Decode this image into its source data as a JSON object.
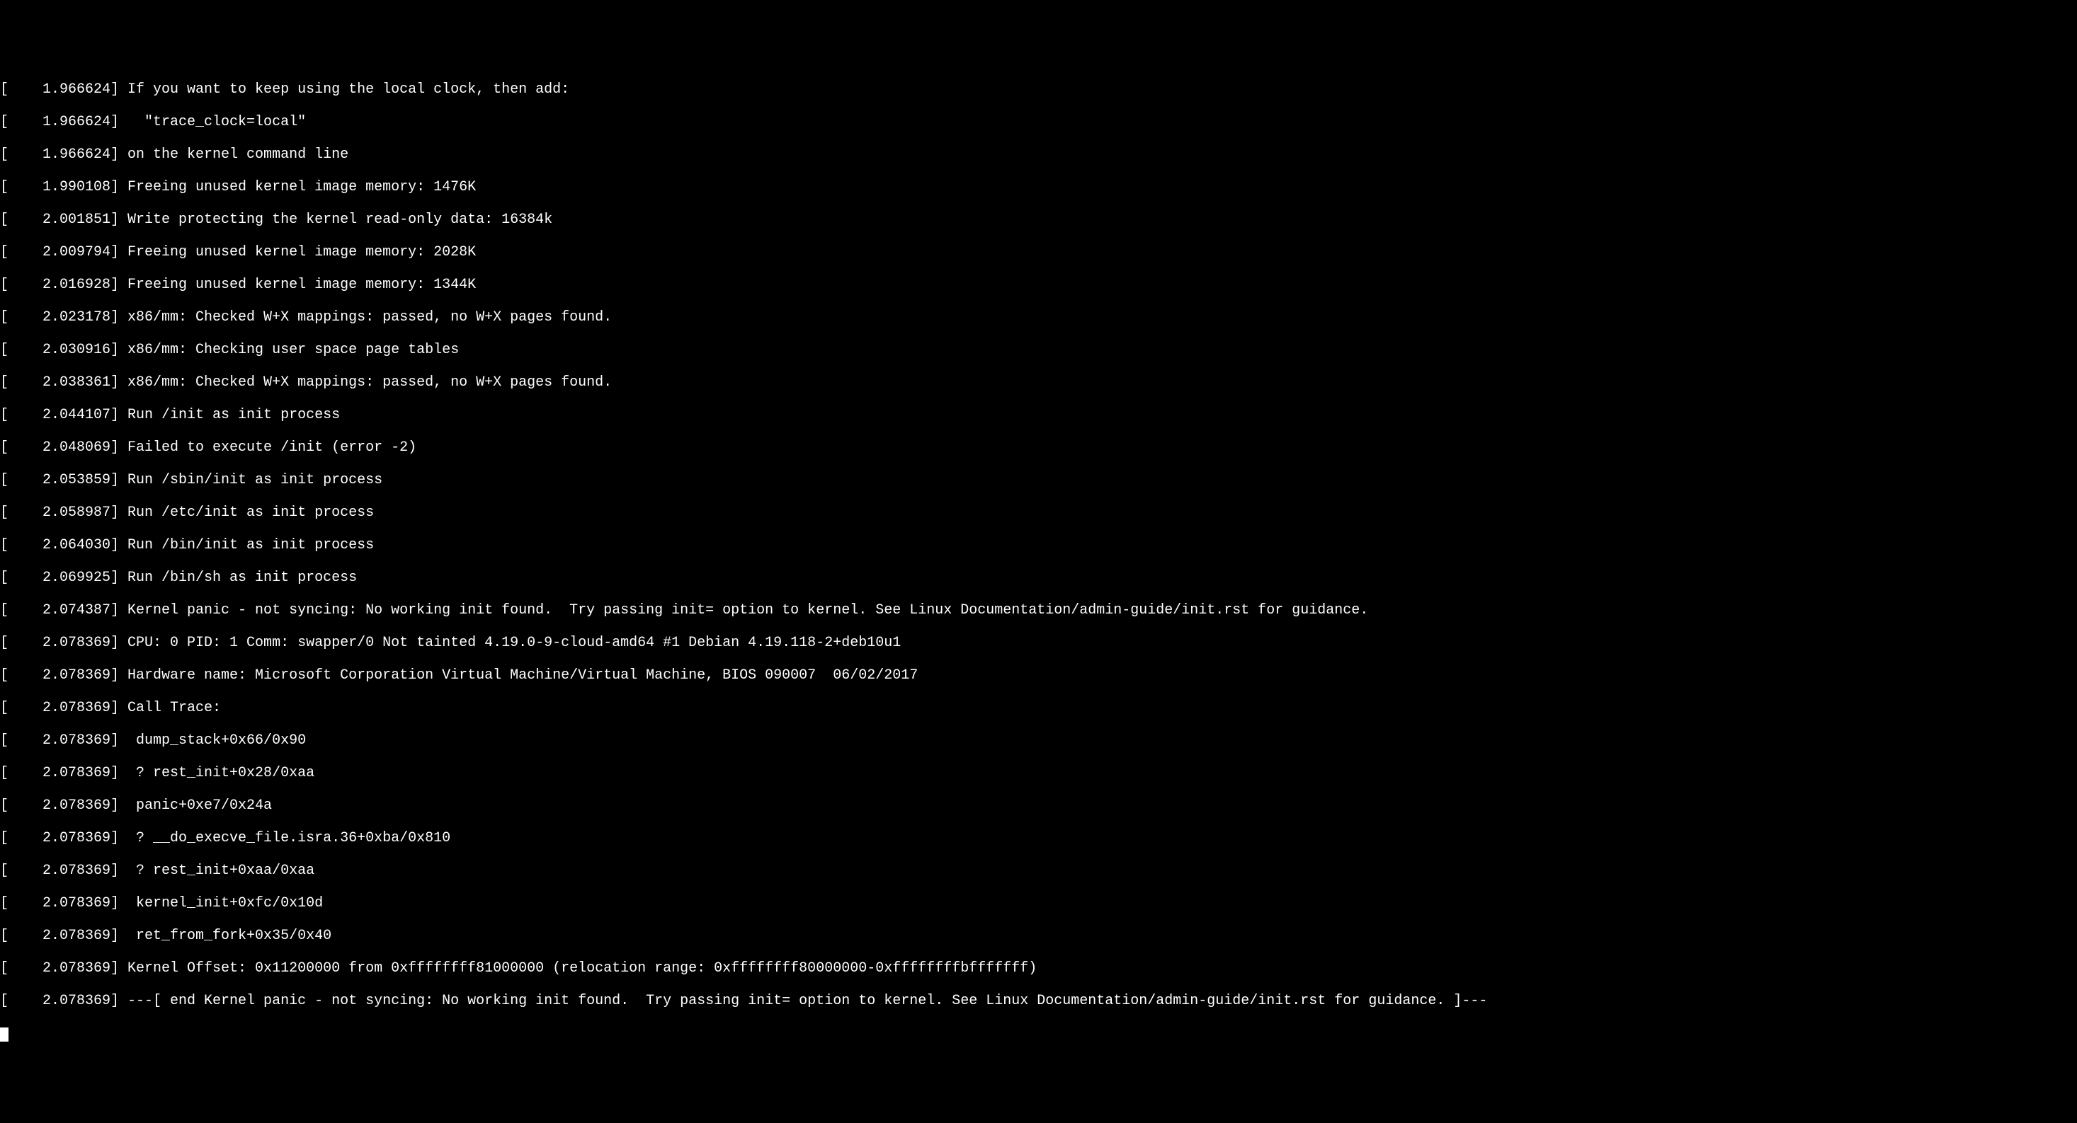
{
  "lines": [
    "[    1.966624] If you want to keep using the local clock, then add:",
    "[    1.966624]   \"trace_clock=local\"",
    "[    1.966624] on the kernel command line",
    "[    1.990108] Freeing unused kernel image memory: 1476K",
    "[    2.001851] Write protecting the kernel read-only data: 16384k",
    "[    2.009794] Freeing unused kernel image memory: 2028K",
    "[    2.016928] Freeing unused kernel image memory: 1344K",
    "[    2.023178] x86/mm: Checked W+X mappings: passed, no W+X pages found.",
    "[    2.030916] x86/mm: Checking user space page tables",
    "[    2.038361] x86/mm: Checked W+X mappings: passed, no W+X pages found.",
    "[    2.044107] Run /init as init process",
    "[    2.048069] Failed to execute /init (error -2)",
    "[    2.053859] Run /sbin/init as init process",
    "[    2.058987] Run /etc/init as init process",
    "[    2.064030] Run /bin/init as init process",
    "[    2.069925] Run /bin/sh as init process",
    "[    2.074387] Kernel panic - not syncing: No working init found.  Try passing init= option to kernel. See Linux Documentation/admin-guide/init.rst for guidance.",
    "[    2.078369] CPU: 0 PID: 1 Comm: swapper/0 Not tainted 4.19.0-9-cloud-amd64 #1 Debian 4.19.118-2+deb10u1",
    "[    2.078369] Hardware name: Microsoft Corporation Virtual Machine/Virtual Machine, BIOS 090007  06/02/2017",
    "[    2.078369] Call Trace:",
    "[    2.078369]  dump_stack+0x66/0x90",
    "[    2.078369]  ? rest_init+0x28/0xaa",
    "[    2.078369]  panic+0xe7/0x24a",
    "[    2.078369]  ? __do_execve_file.isra.36+0xba/0x810",
    "[    2.078369]  ? rest_init+0xaa/0xaa",
    "[    2.078369]  kernel_init+0xfc/0x10d",
    "[    2.078369]  ret_from_fork+0x35/0x40",
    "[    2.078369] Kernel Offset: 0x11200000 from 0xffffffff81000000 (relocation range: 0xffffffff80000000-0xffffffffbfffffff)",
    "[    2.078369] ---[ end Kernel panic - not syncing: No working init found.  Try passing init= option to kernel. See Linux Documentation/admin-guide/init.rst for guidance. ]---"
  ]
}
